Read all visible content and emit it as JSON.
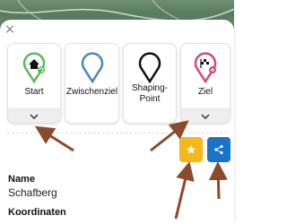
{
  "waypoints": [
    {
      "label": "Start",
      "icon": "start-home-pin-icon",
      "color": "#5cb85c",
      "has_expand": true
    },
    {
      "label": "Zwischenziel",
      "icon": "via-pin-icon",
      "color": "#4a86c5",
      "has_expand": false
    },
    {
      "label": "Shaping-\nPoint",
      "icon": "shaping-point-pin-icon",
      "color": "#111111",
      "has_expand": false
    },
    {
      "label": "Ziel",
      "icon": "destination-flag-pin-icon",
      "color": "#d04a7a",
      "has_expand": true
    }
  ],
  "actions": {
    "favorite": {
      "icon": "star-icon",
      "color": "#f4b81c"
    },
    "share": {
      "icon": "share-icon",
      "color": "#1a73c8"
    }
  },
  "details": {
    "name_label": "Name",
    "name_value": "Schafberg",
    "coords_label": "Koordinaten"
  },
  "annotation_color": "#8b4a2b"
}
